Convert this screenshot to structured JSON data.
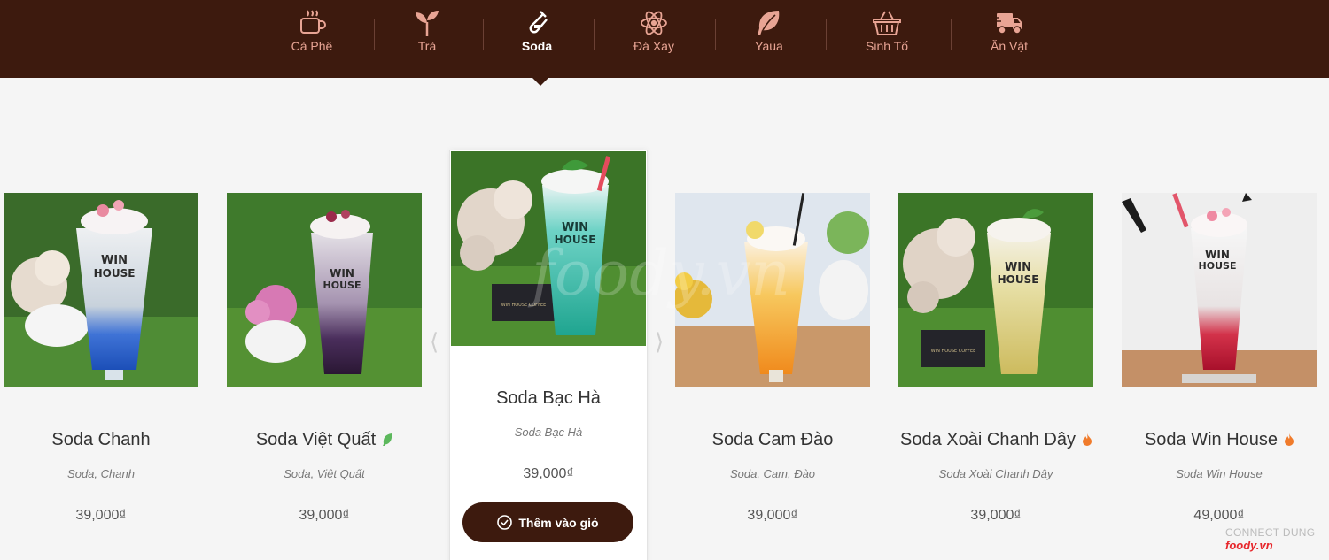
{
  "nav": {
    "items": [
      {
        "label": "Cà Phê",
        "icon": "coffee-cup-icon"
      },
      {
        "label": "Trà",
        "icon": "sprout-icon"
      },
      {
        "label": "Soda",
        "icon": "test-tube-icon",
        "active": true
      },
      {
        "label": "Đá Xay",
        "icon": "atom-icon"
      },
      {
        "label": "Yaua",
        "icon": "leaf-icon"
      },
      {
        "label": "Sinh Tố",
        "icon": "basket-icon"
      },
      {
        "label": "Ăn Vặt",
        "icon": "delivery-truck-icon"
      }
    ]
  },
  "products": [
    {
      "name": "Soda Chanh",
      "desc": "Soda, Chanh",
      "price": "39,000₫"
    },
    {
      "name": "Soda Việt Quất",
      "desc": "Soda, Việt Quất",
      "price": "39,000₫",
      "badge": "leaf-badge-icon"
    },
    {
      "name": "Soda Bạc Hà",
      "desc": "Soda Bạc Hà",
      "price": "39,000₫",
      "featured": true
    },
    {
      "name": "Soda Cam Đào",
      "desc": "Soda, Cam, Đào",
      "price": "39,000₫"
    },
    {
      "name": "Soda Xoài Chanh Dây",
      "desc": "Soda Xoài Chanh Dây",
      "price": "39,000₫",
      "badge": "fire-badge-icon"
    },
    {
      "name": "Soda Win House",
      "desc": "Soda Win House",
      "price": "49,000₫",
      "badge": "fire-badge-icon"
    }
  ],
  "featured": {
    "add_to_cart_label": "Thêm vào giỏ"
  },
  "watermark": {
    "text": "foody.vn",
    "connect": "CONNECT DUNG",
    "brand": "foody.vn"
  },
  "colors": {
    "nav_bg": "#3d1a0e",
    "nav_icon": "#e8a494",
    "nav_active": "#ffffff",
    "leaf_badge": "#5cb85c",
    "fire_badge": "#f07b2b"
  }
}
